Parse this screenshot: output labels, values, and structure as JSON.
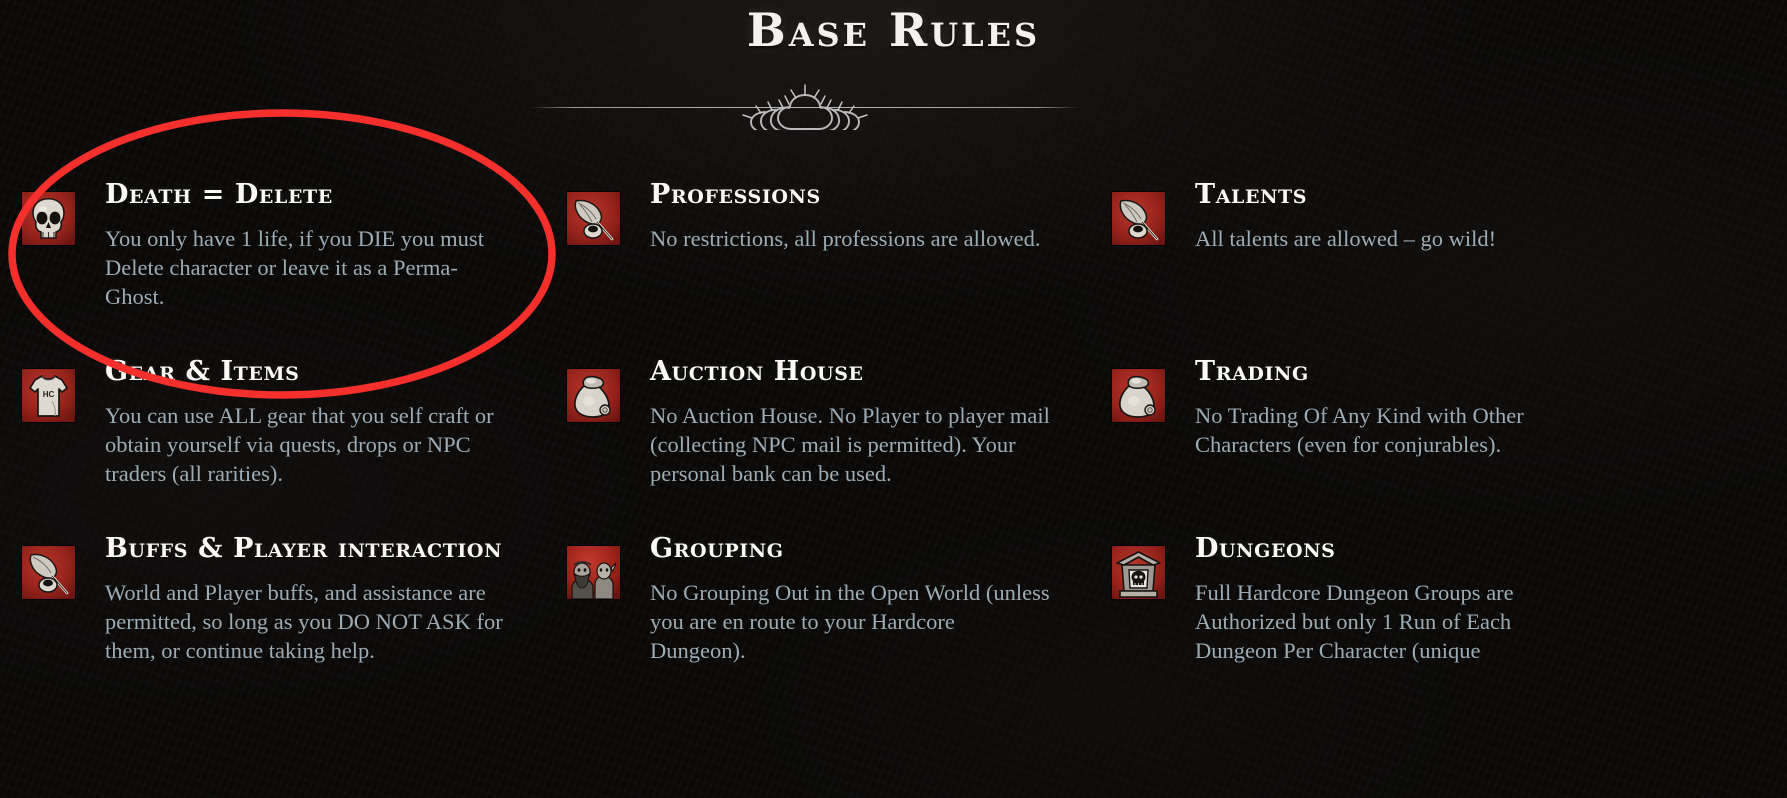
{
  "header": {
    "title": "Base Rules",
    "divider_ornament_icon": "thorn-crown-ornament"
  },
  "annotation": {
    "shape": "ellipse",
    "color": "#f5302c",
    "target": "Death = Delete",
    "stroke_width": 7.5
  },
  "colors": {
    "background": "#0a0908",
    "title_text": "#f4f2ee",
    "rule_title_text": "#fbfaf7",
    "body_text": "#9dacb4",
    "icon_background": "#a52119",
    "annotation_red": "#f5302c"
  },
  "rules": [
    {
      "title": "Death = Delete",
      "body": "You only have 1 life, if you DIE you must Delete character or leave it as a Perma-Ghost.",
      "icon": "skull-icon"
    },
    {
      "title": "Professions",
      "body": "No restrictions, all professions are allowed.",
      "icon": "quill-and-inkwell-icon"
    },
    {
      "title": "Talents",
      "body": "All talents are allowed – go wild!",
      "icon": "quill-and-inkwell-icon"
    },
    {
      "title": "Gear & Items",
      "body": "You can use ALL gear that you self craft or obtain yourself via quests, drops or NPC traders (all rarities).",
      "icon": "shirt-icon"
    },
    {
      "title": "Auction House",
      "body": "No Auction House. No Player to player mail (collecting NPC mail is permitted). Your personal bank can be used.",
      "icon": "coin-pouch-icon"
    },
    {
      "title": "Trading",
      "body": "No Trading Of Any Kind with Other Characters (even for conjurables).",
      "icon": "coin-pouch-icon"
    },
    {
      "title": "Buffs & Player interaction",
      "body": "World and Player buffs, and assistance are permitted, so long as you DO NOT ASK for them, or continue taking help.",
      "icon": "party-members-icon"
    },
    {
      "title": "Grouping",
      "body": "No Grouping Out in the Open World (unless you are en route to your Hardcore Dungeon).",
      "icon": "party-members-icon"
    },
    {
      "title": "Dungeons",
      "body": "Full Hardcore Dungeon Groups are Authorized but only 1 Run of Each Dungeon Per Character (unique",
      "icon": "dungeon-portal-icon"
    }
  ]
}
